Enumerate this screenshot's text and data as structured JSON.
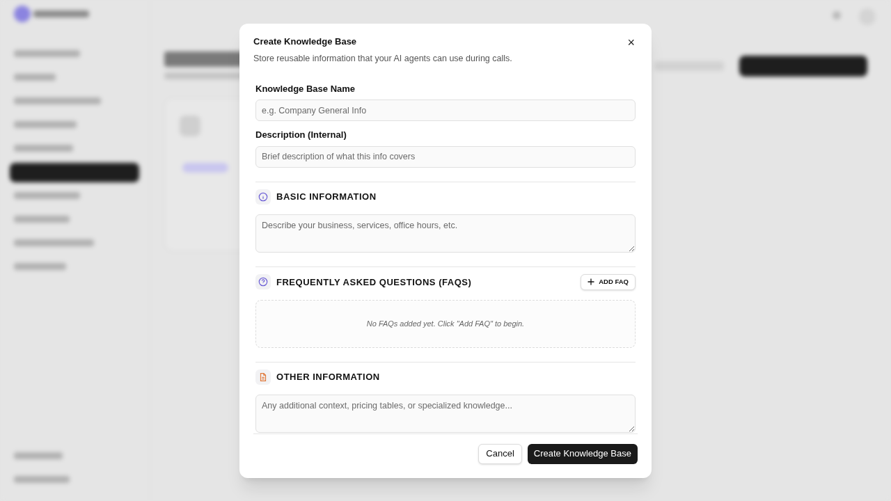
{
  "dialog": {
    "title": "Create Knowledge Base",
    "subtitle": "Store reusable information that your AI agents can use during calls.",
    "close": "×",
    "fields": [
      {
        "label": "Knowledge Base Name",
        "placeholder": "e.g. Company General Info"
      },
      {
        "label": "Description (Internal)",
        "placeholder": "Brief description of what this info covers"
      }
    ],
    "sections": [
      {
        "kind": "text",
        "title": "BASIC INFORMATION",
        "placeholder": "Describe your business, services, office hours, etc."
      },
      {
        "kind": "faq",
        "title": "FREQUENTLY ASKED QUESTIONS (FAQS)",
        "button": "ADD FAQ",
        "empty": "No FAQs added yet. Click \"Add FAQ\" to begin."
      },
      {
        "kind": "text",
        "title": "OTHER INFORMATION",
        "placeholder": "Any additional context, pricing tables, or specialized knowledge..."
      }
    ],
    "buttons": [
      {
        "kind": "secondary",
        "label": "Cancel"
      },
      {
        "kind": "primary",
        "label": "Create Knowledge Base"
      }
    ]
  }
}
